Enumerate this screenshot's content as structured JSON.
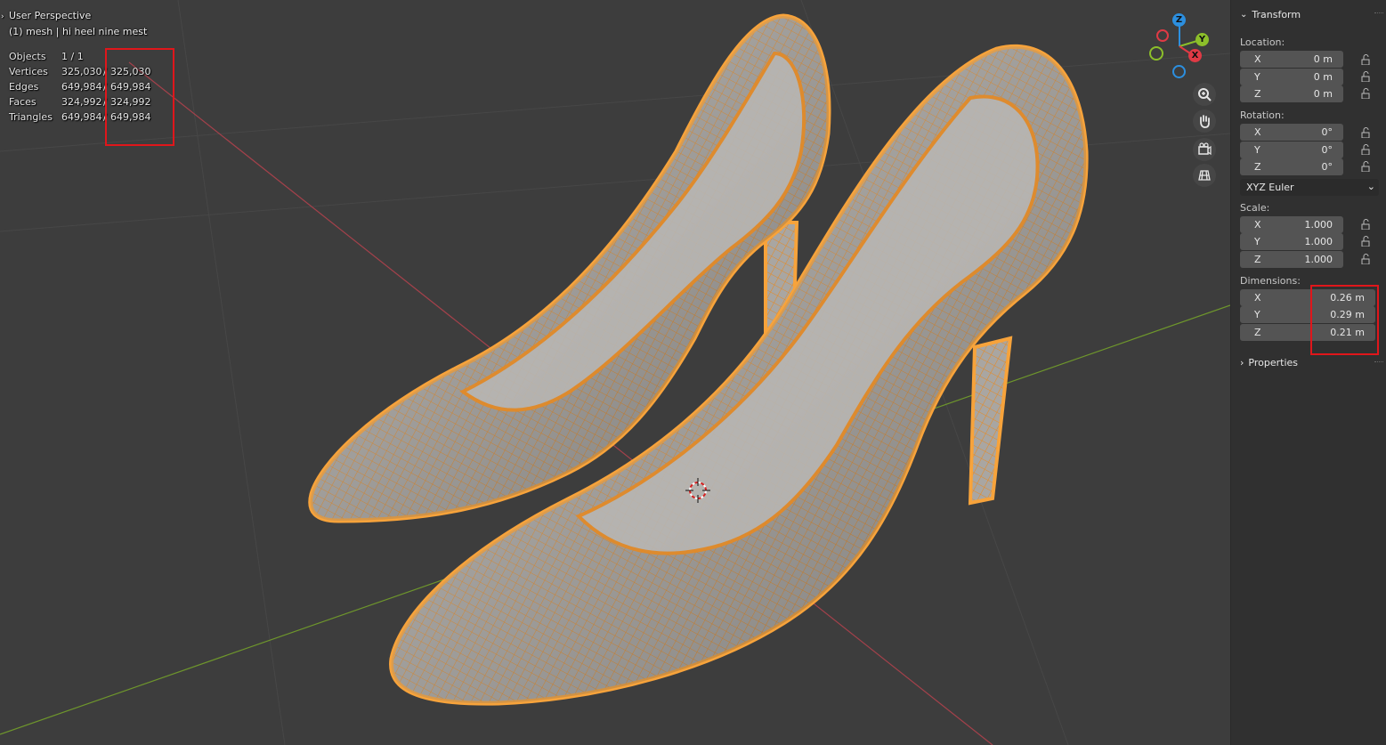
{
  "viewport": {
    "title": "User Perspective",
    "subtitle": "(1) mesh | hi heel nine mest",
    "stats": [
      {
        "label": "Objects",
        "value": "1 / 1",
        "total": ""
      },
      {
        "label": "Vertices",
        "value": "325,030",
        "total": "325,030"
      },
      {
        "label": "Edges",
        "value": "649,984",
        "total": "649,984"
      },
      {
        "label": "Faces",
        "value": "324,992",
        "total": "324,992"
      },
      {
        "label": "Triangles",
        "value": "649,984",
        "total": "649,984"
      }
    ],
    "stats_separator": "/",
    "gizmo": {
      "z": "Z",
      "y": "Y",
      "x": "X"
    },
    "nav_buttons": [
      "zoom-icon",
      "hand-pan-icon",
      "camera-icon",
      "grid-ortho-icon"
    ]
  },
  "panel": {
    "transform_header": "Transform",
    "location_label": "Location:",
    "location": [
      {
        "axis": "X",
        "value": "0 m"
      },
      {
        "axis": "Y",
        "value": "0 m"
      },
      {
        "axis": "Z",
        "value": "0 m"
      }
    ],
    "rotation_label": "Rotation:",
    "rotation": [
      {
        "axis": "X",
        "value": "0°"
      },
      {
        "axis": "Y",
        "value": "0°"
      },
      {
        "axis": "Z",
        "value": "0°"
      }
    ],
    "rotation_mode": "XYZ Euler",
    "scale_label": "Scale:",
    "scale": [
      {
        "axis": "X",
        "value": "1.000"
      },
      {
        "axis": "Y",
        "value": "1.000"
      },
      {
        "axis": "Z",
        "value": "1.000"
      }
    ],
    "dimensions_label": "Dimensions:",
    "dimensions": [
      {
        "axis": "X",
        "value": "0.26 m"
      },
      {
        "axis": "Y",
        "value": "0.29 m"
      },
      {
        "axis": "Z",
        "value": "0.21 m"
      }
    ],
    "properties_header": "Properties"
  },
  "colors": {
    "background": "#3d3d3d",
    "panel": "#303030",
    "field": "#545454",
    "selection_outline": "#f7a33b",
    "highlight_box": "#e0161b",
    "x_axis": "#a4414b",
    "y_axis": "#6e962c"
  }
}
